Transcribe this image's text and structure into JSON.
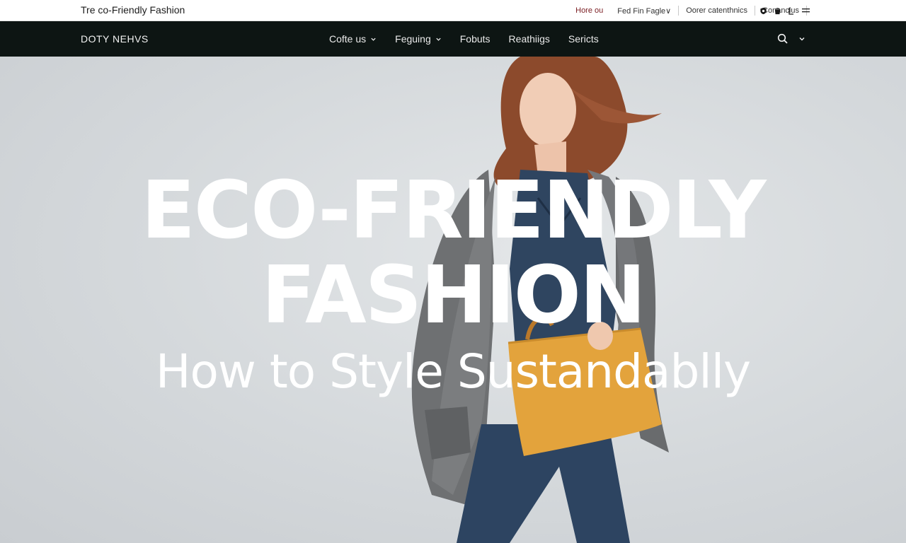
{
  "topbar": {
    "site_title": "Tre co-Friendly Fashion",
    "links": [
      "Hore ou",
      "Fed Fin Fagle∨",
      "Oorer catenthnics",
      "Conanclus"
    ]
  },
  "navbar": {
    "brand": "DOTY NEHVS",
    "menu": [
      {
        "label": "Cofte us",
        "dropdown": true
      },
      {
        "label": "Feguing",
        "dropdown": true
      },
      {
        "label": "Fobuts",
        "dropdown": false
      },
      {
        "label": "Reathiigs",
        "dropdown": false
      },
      {
        "label": "Sericts",
        "dropdown": false
      }
    ]
  },
  "hero": {
    "headline_line1": "ECO-FRIENDLY",
    "headline_line2": "FASHION",
    "subheadline": "How to Style Sustandablly"
  },
  "icons": [
    "shield-icon",
    "bag-icon",
    "user-icon",
    "menu-icon",
    "search-icon",
    "chevron-down-icon"
  ],
  "colors": {
    "nav_background": "#0d1513",
    "active_link": "#7a1d22",
    "bag": "#e3a33c",
    "coat": "#6e7072",
    "denim": "#2f4560"
  }
}
